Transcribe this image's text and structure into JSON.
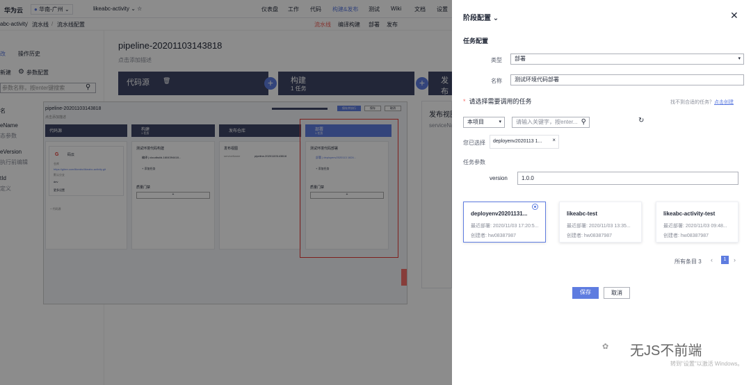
{
  "topnav": {
    "logo": "华为云",
    "region": "华南-广州",
    "project": "likeabc-activity",
    "items": [
      "仪表盘",
      "工作",
      "代码",
      "构建&发布",
      "测试",
      "Wiki",
      "文档",
      "设置"
    ]
  },
  "subnav": {
    "breadcrumb": [
      "abc-activity",
      "流水线",
      "流水线配置"
    ],
    "tabs": [
      "流水线",
      "编译构建",
      "部署",
      "发布"
    ]
  },
  "left": {
    "tabs": [
      "改",
      "操作历史"
    ],
    "actions": [
      "新建",
      "参数配置"
    ],
    "search_placeholder": "参数名称，按enter键搜索",
    "rows": [
      {
        "name": "名",
        "value": ""
      },
      {
        "name": "eName",
        "value": "态参数"
      },
      {
        "name": "eVersion",
        "value": "执行前编辑"
      },
      {
        "name": "tId",
        "value": "定义"
      }
    ]
  },
  "pipeline": {
    "title": "pipeline-20201103143818",
    "desc": "点击添加描述",
    "stages": [
      {
        "name": "代码源",
        "count": ""
      },
      {
        "name": "构建",
        "count": "1 任务"
      },
      {
        "name": "发布",
        "count": ""
      }
    ],
    "right_card_title": "发布视图",
    "right_card_sub": "serviceNa"
  },
  "inner": {
    "title": "pipeline-20201103143818",
    "desc": "点击添加描述",
    "stages": [
      "代码源",
      "构建",
      "发布仓库",
      "部署"
    ],
    "stage_counts": [
      "",
      "1 任务",
      "",
      "1 任务"
    ],
    "source_card": {
      "title": "码云",
      "addr_label": "仓库",
      "addr": "https://gitee.com/likeabc/likeabc-activity.git",
      "branch_label": "默认分支",
      "branch": "dev",
      "more": "更多设置"
    },
    "add_source": "+ 代码源",
    "build_task": {
      "title": "测试环境代码构建",
      "sub": "编译 | cloudbuild-1604394418...",
      "add": "+ 添加任务"
    },
    "quality_gate": "质量门禁",
    "release": {
      "title": "发布视图",
      "key": "serviceName",
      "value": "pipeline-20201103143818"
    },
    "deploy_task": {
      "title": "测试环境代码部署",
      "sub": "部署 | deployenv2020113 1824...",
      "add": "+ 添加任务"
    },
    "buttons": [
      "保存并执行",
      "保存",
      "取消"
    ]
  },
  "panel": {
    "title": "阶段配置",
    "section": "任务配置",
    "type_label": "类型",
    "type_value": "部署",
    "name_label": "名称",
    "name_value": "测试环境代码部署",
    "choose_title": "请选择需要调用的任务",
    "not_found": "找不到合适的任务？",
    "create_link": "点击创建",
    "scope": "本项目",
    "search_placeholder": "请输入关键字，按enter...",
    "selected_label": "您已选择",
    "selected_chip": "deployenv2020113 1...",
    "params_label": "任务参数",
    "version_label": "version",
    "version_value": "1.0.0",
    "tasks": [
      {
        "title": "deployenv20201131...",
        "recent": "最近部署: 2020/11/03 17:20:5...",
        "creator": "创建者: hw08387987",
        "selected": true
      },
      {
        "title": "likeabc-test",
        "recent": "最近部署: 2020/11/03 13:35...",
        "creator": "创建者: hw08387987",
        "selected": false
      },
      {
        "title": "likeabc-activity-test",
        "recent": "最近部署: 2020/11/03 09:48...",
        "creator": "创建者: hw08387987",
        "selected": false
      }
    ],
    "pager_total": "所有条目 3",
    "pager_page": "1",
    "save": "保存",
    "cancel": "取消",
    "watermark": "无JS不前端",
    "activate": "转到\"设置\"以激活 Windows。"
  },
  "colors": {
    "accent": "#5e7ce0",
    "stage_bg": "#3e4666",
    "required": "#f66f6a",
    "highlight": "#e53935"
  }
}
